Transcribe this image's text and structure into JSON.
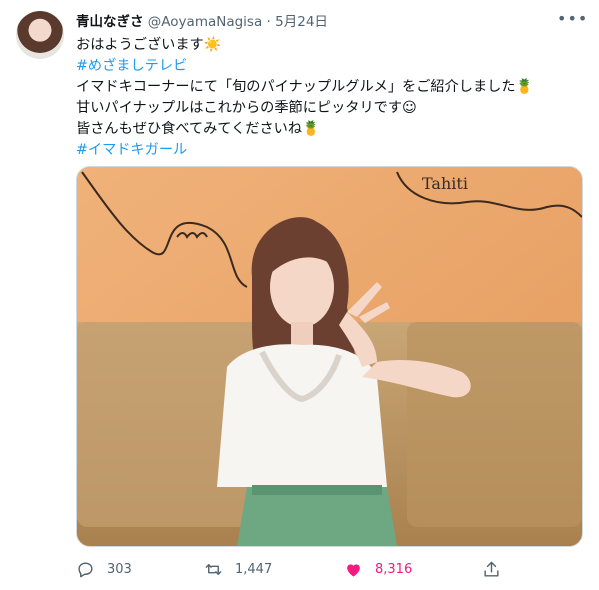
{
  "tweet": {
    "display_name": "青山なぎさ",
    "handle": "@AoyamaNagisa",
    "separator": "·",
    "date": "5月24日",
    "lines": [
      {
        "text": "おはようございます",
        "emoji": "☀️"
      },
      {
        "text": "#めざましテレビ",
        "link": true
      },
      {
        "text": "イマドキコーナーにて「旬のパイナップルグルメ」をご紹介しました",
        "emoji": "🍍"
      },
      {
        "text": "甘いパイナップルはこれからの季節にピッタリです",
        "emoji": "☺"
      },
      {
        "text": "皆さんもぜひ食べてみてくださいね",
        "emoji": "🍍"
      },
      {
        "text": "#イマドキガール",
        "link": true
      }
    ],
    "photo_wall_text": "Tahiti"
  },
  "actions": {
    "reply_count": "303",
    "retweet_count": "1,447",
    "like_count": "8,316"
  },
  "icons": {
    "more": "more-icon",
    "reply": "reply-icon",
    "retweet": "retweet-icon",
    "like": "heart-icon",
    "share": "share-icon"
  },
  "colors": {
    "link": "#1d9bf0",
    "like": "#f91880",
    "muted": "#536471"
  }
}
